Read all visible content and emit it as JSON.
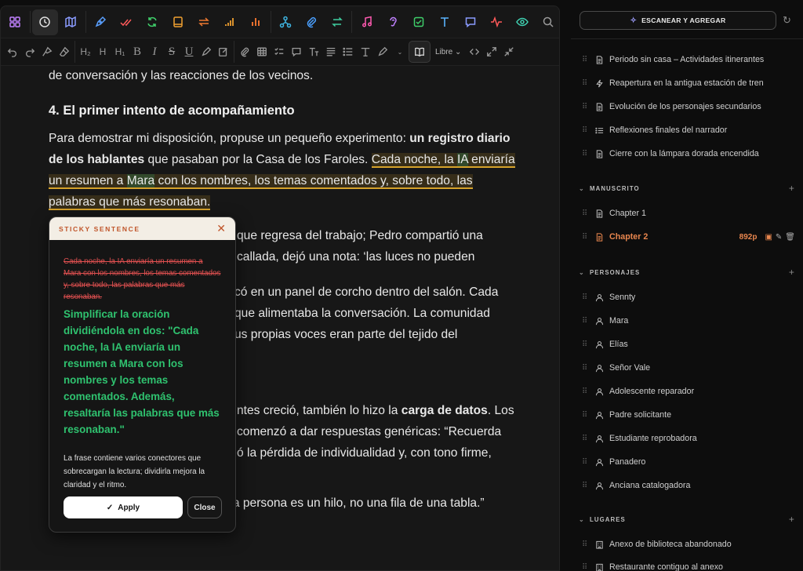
{
  "toolbar_top": {
    "icons": [
      "grid-icon",
      "clock-icon",
      "map-icon",
      "pen-icon",
      "double-check-icon",
      "refresh-icon",
      "book-icon",
      "swap-icon",
      "signal-icon",
      "bar-chart-icon",
      "network-icon",
      "paperclip-icon",
      "arrows-icon",
      "music-icon",
      "ear-icon",
      "checkbox-icon",
      "text-icon",
      "chat-icon",
      "pulse-icon",
      "eye-icon",
      "search-icon"
    ],
    "icon_colors": [
      "#c081ff",
      "#e0e0e0",
      "#8a9bff",
      "#5aa0ff",
      "#ff5a5a",
      "#3fcf6a",
      "#f0a030",
      "#f07a30",
      "#f0a030",
      "#ff7a30",
      "#3fb4e0",
      "#4aa0ff",
      "#3fcfa0",
      "#ff5ab0",
      "#c081ff",
      "#3fcf6a",
      "#5ab4ff",
      "#8a9bff",
      "#ff5a5a",
      "#3fcfb0",
      "#9a9a9a"
    ]
  },
  "format_toolbar": {
    "h2": "H₂",
    "h_more": "H",
    "h1": "H₁",
    "bold": "B",
    "italic": "I",
    "strike": "S",
    "underline": "U",
    "style_label": "Libre"
  },
  "document": {
    "intro_tail": "de conversación y las reacciones de los vecinos.",
    "heading": "4. El primer intento de acompañamiento",
    "para1_start": "Para demostrar mi disposición, propuse un pequeño experimento: ",
    "para1_bold": "un registro diario de los hablantes",
    "para1_mid": " que pasaban por la Casa de los Faroles. ",
    "para1_hl_a": "Cada noche, la ",
    "para1_hl_ia": "IA",
    "para1_hl_b": " enviaría un resumen a ",
    "para1_hl_mara": "Mara",
    "para1_hl_c": " con los nombres, los temas comentados y, sobre todo, las palabras que más resonaban.",
    "para2_l1": "que regresa del trabajo; Pedro compartió una",
    "para2_l2": "callada, dejó una nota: ‘las luces no pueden",
    "para3_l1": "có en un panel de corcho dentro del salón. Cada",
    "para3_l2": "que alimentaba la conversación. La comunidad",
    "para3_l3": "us propias voces eran parte del tejido del",
    "para4_l1a": "ntes creció, también lo hizo la ",
    "para4_l1b": "carga de datos",
    "para4_l1c": ". Los",
    "para4_l2": "comenzó a dar respuestas genéricas: “Recuerda",
    "para4_l3": "ó la pérdida de individualidad y, con tono firme,",
    "quote": "“Necesitamos volver a la raíz: cada persona es un hilo, no una fila de una tabla.”"
  },
  "popup": {
    "title": "STICKY SENTENCE",
    "original": "Cada noche, la IA enviaría un resumen a Mara con los nombres, los temas comentados y, sobre todo, las palabras que más resonaban.",
    "suggestion": "Simplificar la oración dividiéndola en dos: \"Cada noche, la IA enviaría un resumen a Mara con los nombres y los temas comentados. Además, resaltaría las palabras que más resonaban.\"",
    "explanation": "La frase contiene varios conectores que sobrecargan la lectura; dividirla mejora la claridad y el ritmo.",
    "apply_label": "Apply",
    "close_label": "Close"
  },
  "sidebar": {
    "scan_button": "ESCANEAR Y AGREGAR",
    "outline_items": [
      {
        "label": "Periodo sin casa – Actividades itinerantes",
        "icon": "document-icon"
      },
      {
        "label": "Reapertura en la antigua estación de tren",
        "icon": "bolt-icon"
      },
      {
        "label": "Evolución de los personajes secundarios",
        "icon": "document-icon"
      },
      {
        "label": "Reflexiones finales del narrador",
        "icon": "list-icon"
      },
      {
        "label": "Cierre con la lámpara dorada encendida",
        "icon": "document-icon"
      }
    ],
    "manuscript": {
      "title": "MANUSCRITO",
      "chapters": [
        {
          "label": "Chapter 1"
        },
        {
          "label": "Chapter 2",
          "count": "892p",
          "active": true
        }
      ]
    },
    "characters": {
      "title": "PERSONAJES",
      "items": [
        "Sennty",
        "Mara",
        "Elías",
        "Señor Vale",
        "Adolescente reparador",
        "Padre solicitante",
        "Estudiante reprobadora",
        "Panadero",
        "Anciana catalogadora"
      ]
    },
    "places": {
      "title": "LUGARES",
      "items": [
        "Anexo de biblioteca abandonado",
        "Restaurante contiguo al anexo"
      ]
    }
  },
  "colors": {
    "accent_orange": "#e8864e",
    "suggestion_green": "#2fc26f",
    "strike_red": "#e05050",
    "highlight_gold": "#d6a22a"
  }
}
